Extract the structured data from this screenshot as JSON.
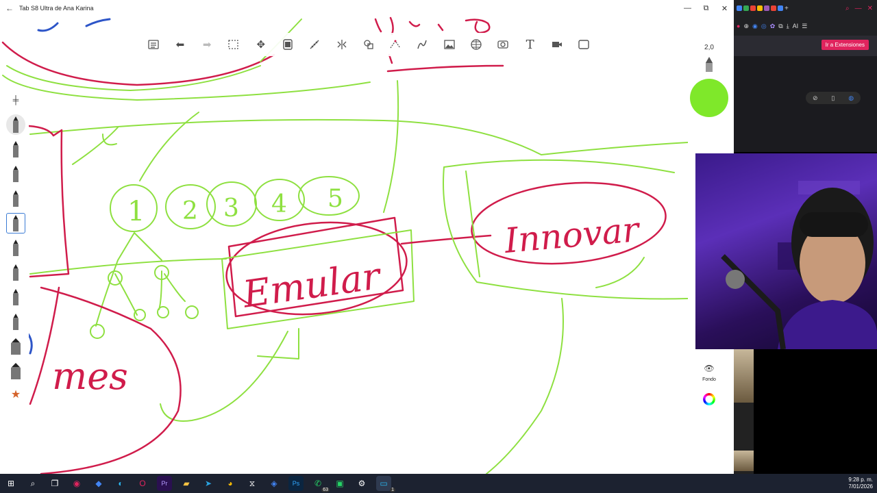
{
  "window": {
    "title": "Tab S8 Ultra de Ana Karina",
    "back_icon": "arrow-left-icon",
    "minimize": "—",
    "maximize": "⧉",
    "close": "✕"
  },
  "toolbar": {
    "tools": [
      "menu-icon",
      "undo-icon",
      "redo-icon",
      "selection-icon",
      "transform-icon",
      "layers-icon",
      "ruler-icon",
      "symmetry-icon",
      "shapes-icon",
      "perspective-icon",
      "curve-icon",
      "image-icon",
      "grid-icon",
      "scan-icon",
      "text-icon",
      "video-icon",
      "fullscreen-icon"
    ]
  },
  "right_panel": {
    "brush_size": "2,0",
    "current_color": "#7fe82a",
    "background_label": "Fondo"
  },
  "canvas": {
    "words": {
      "emular": "Emular",
      "innovar": "Innovar",
      "mes": "mes"
    },
    "numbers": [
      "1",
      "2",
      "3",
      "4",
      "5"
    ],
    "colors": {
      "red": "#d01c4b",
      "green": "#8ee040",
      "blue": "#2d55c8"
    }
  },
  "browser": {
    "extensions_button": "Ir a Extensiones",
    "ai_label": "AI"
  },
  "taskbar": {
    "badge_whatsapp": "63",
    "badge_app": "1",
    "time": "9:28 p. m.",
    "date": "7/01/2026"
  }
}
